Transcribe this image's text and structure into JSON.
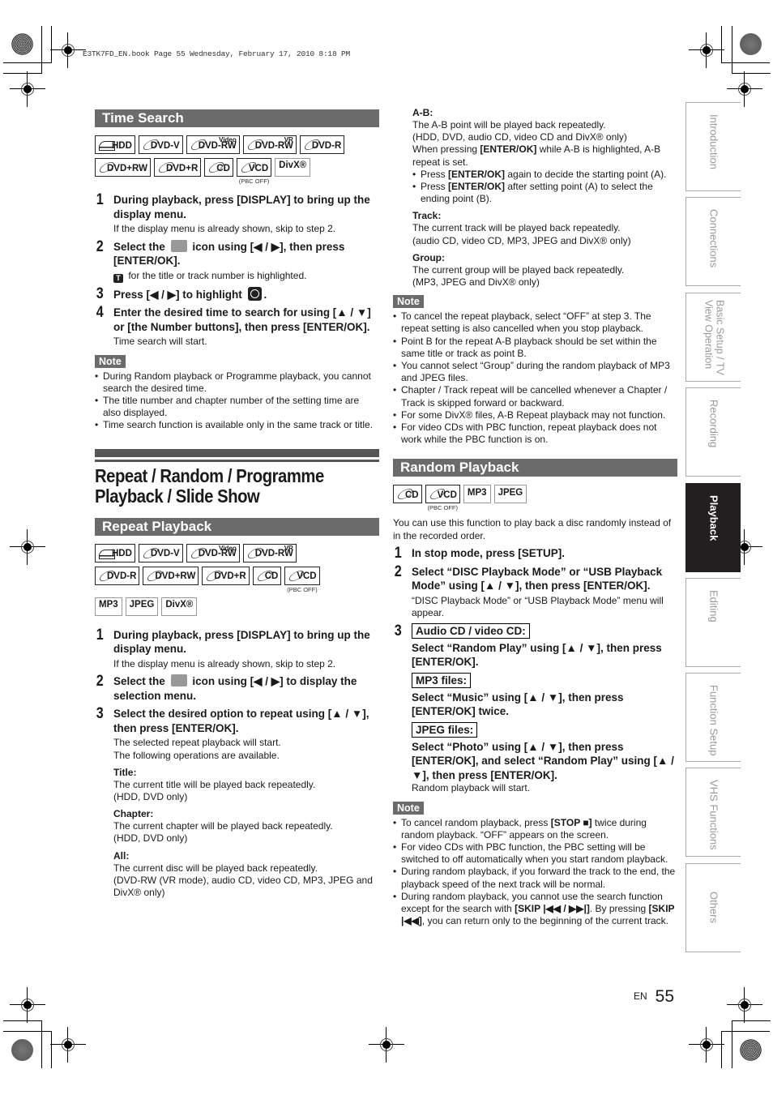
{
  "slug": "E3TK7FD_EN.book  Page 55  Wednesday, February 17, 2010  8:18 PM",
  "time_search": {
    "heading": "Time Search",
    "media_row1": [
      {
        "label": "HDD",
        "type": "hdd"
      },
      {
        "label": "DVD-V",
        "type": "disc"
      },
      {
        "label": "DVD-RW",
        "type": "disc",
        "sup": "Video"
      },
      {
        "label": "DVD-RW",
        "type": "disc",
        "sup": "VR"
      },
      {
        "label": "DVD-R",
        "type": "disc"
      }
    ],
    "media_row2": [
      {
        "label": "DVD+RW",
        "type": "disc"
      },
      {
        "label": "DVD+R",
        "type": "disc"
      },
      {
        "label": "CD",
        "type": "disc"
      },
      {
        "label": "VCD",
        "type": "disc",
        "note": "(PBC OFF)"
      },
      {
        "label": "DivX®",
        "type": "plain"
      }
    ],
    "steps": [
      {
        "num": "1",
        "text": "During playback, press [DISPLAY] to bring up the display menu.",
        "sub": "If the display menu is already shown, skip to step 2."
      },
      {
        "num": "2",
        "text_a": "Select the",
        "text_b": "icon using [◀ / ▶], then press [ENTER/OK].",
        "sub_icon": "T",
        "sub": "for the title or track number is highlighted."
      },
      {
        "num": "3",
        "text": "Press [◀ / ▶] to highlight",
        "icon": "clock-icon"
      },
      {
        "num": "4",
        "text": "Enter the desired time to search for using [▲ / ▼] or [the Number buttons], then press [ENTER/OK].",
        "sub": "Time search will start."
      }
    ],
    "note_label": "Note",
    "notes": [
      "During Random playback or Programme playback, you cannot search the desired time.",
      "The title number and chapter number of the setting time are also displayed.",
      "Time search function is available only in the same track or title."
    ]
  },
  "chapter_title": "Repeat / Random / Programme Playback / Slide Show",
  "repeat": {
    "heading": "Repeat Playback",
    "media_row1": [
      {
        "label": "HDD",
        "type": "hdd"
      },
      {
        "label": "DVD-V",
        "type": "disc"
      },
      {
        "label": "DVD-RW",
        "type": "disc",
        "sup": "Video"
      },
      {
        "label": "DVD-RW",
        "type": "disc",
        "sup": "VR"
      }
    ],
    "media_row2": [
      {
        "label": "DVD-R",
        "type": "disc"
      },
      {
        "label": "DVD+RW",
        "type": "disc"
      },
      {
        "label": "DVD+R",
        "type": "disc"
      },
      {
        "label": "CD",
        "type": "disc"
      },
      {
        "label": "VCD",
        "type": "disc",
        "note": "(PBC OFF)"
      }
    ],
    "media_row3": [
      {
        "label": "MP3",
        "type": "plain"
      },
      {
        "label": "JPEG",
        "type": "plain"
      },
      {
        "label": "DivX®",
        "type": "plain"
      }
    ],
    "steps": [
      {
        "num": "1",
        "text": "During playback, press [DISPLAY] to bring up the display menu.",
        "sub": "If the display menu is already shown, skip to step 2."
      },
      {
        "num": "2",
        "text_a": "Select the",
        "text_b": "icon using [◀ / ▶] to display the selection menu."
      },
      {
        "num": "3",
        "text": "Select the desired option to repeat using [▲ / ▼], then press [ENTER/OK].",
        "sub1": "The selected repeat playback will start.",
        "sub2": "The following operations are available."
      }
    ],
    "options": [
      {
        "title": "Title:",
        "lines": [
          "The current title will be played back repeatedly.",
          "(HDD, DVD only)"
        ]
      },
      {
        "title": "Chapter:",
        "lines": [
          "The current chapter will be played back repeatedly.",
          "(HDD, DVD only)"
        ]
      },
      {
        "title": "All:",
        "lines": [
          "The current disc will be played back repeatedly.",
          "(DVD-RW (VR mode), audio CD, video CD, MP3, JPEG and DivX® only)"
        ]
      }
    ],
    "ab": {
      "title": "A-B:",
      "lines": [
        "The A-B point will be played back repeatedly.",
        "(HDD, DVD, audio CD, video CD and DivX® only)"
      ],
      "when_a": "When pressing ",
      "when_b": "[ENTER/OK]",
      "when_c": " while A-B is highlighted, A-B repeat is set.",
      "bullets": [
        {
          "pre": "Press ",
          "key": "[ENTER/OK]",
          "post": " again to decide the starting point (A)."
        },
        {
          "pre": "Press ",
          "key": "[ENTER/OK]",
          "post": " after setting point (A) to select the ending point (B)."
        }
      ]
    },
    "track": {
      "title": "Track:",
      "lines": [
        "The current track will be played back repeatedly.",
        "(audio CD, video CD, MP3, JPEG and DivX® only)"
      ]
    },
    "group": {
      "title": "Group:",
      "lines": [
        "The current group will be played back repeatedly.",
        "(MP3, JPEG and DivX® only)"
      ]
    },
    "note_label": "Note",
    "notes": [
      "To cancel the repeat playback, select “OFF” at step 3. The repeat setting is also cancelled when you stop playback.",
      "Point B for the repeat A-B playback should be set within the same title or track as point B.",
      "You cannot select “Group” during the random playback of MP3 and JPEG files.",
      "Chapter / Track repeat will be cancelled whenever a Chapter / Track is skipped forward or backward.",
      "For some DivX® files, A-B Repeat playback may not function.",
      "For video CDs with PBC function, repeat playback does not work while the PBC function is on."
    ]
  },
  "random": {
    "heading": "Random Playback",
    "media": [
      {
        "label": "CD",
        "type": "disc"
      },
      {
        "label": "VCD",
        "type": "disc",
        "note": "(PBC OFF)"
      },
      {
        "label": "MP3",
        "type": "plain"
      },
      {
        "label": "JPEG",
        "type": "plain"
      }
    ],
    "intro": "You can use this function to play back a disc randomly instead of in the recorded order.",
    "step1": {
      "num": "1",
      "text": "In stop mode, press [SETUP]."
    },
    "step2": {
      "num": "2",
      "text": "Select “DISC Playback Mode” or “USB Playback Mode” using [▲ / ▼], then press [ENTER/OK].",
      "sub": "“DISC Playback Mode” or “USB Playback Mode” menu will appear."
    },
    "step3": {
      "num": "3",
      "cases": [
        {
          "label": "Audio CD / video CD:",
          "text": "Select “Random Play” using [▲ / ▼], then press [ENTER/OK]."
        },
        {
          "label": "MP3 files:",
          "text": "Select “Music” using [▲ / ▼], then press [ENTER/OK] twice."
        },
        {
          "label": "JPEG files:",
          "text": "Select “Photo” using [▲ / ▼], then press [ENTER/OK], and select “Random Play” using [▲ / ▼], then press [ENTER/OK]."
        }
      ],
      "sub": "Random playback will start."
    },
    "note_label": "Note",
    "notes": [
      {
        "pre": "To cancel random playback, press ",
        "key": "[STOP ■]",
        "post": " twice during random playback. “OFF” appears on the screen."
      },
      {
        "pre": "For video CDs with PBC function, the PBC setting will be switched to off automatically when you start random playback.",
        "key": "",
        "post": ""
      },
      {
        "pre": "During random playback, if you forward the track to the end, the playback speed of the next track will be normal.",
        "key": "",
        "post": ""
      },
      {
        "pre": "During random playback, you cannot use the search function except for the search with ",
        "key": "[SKIP |◀◀ / ▶▶|]",
        "post": ". By pressing ",
        "key2": "[SKIP |◀◀]",
        "post2": ", you can return only to the beginning of the current track."
      }
    ]
  },
  "side_tabs": [
    {
      "label": "Introduction",
      "active": false
    },
    {
      "label": "Connections",
      "active": false
    },
    {
      "label": "Basic Setup / TV View Operation",
      "active": false
    },
    {
      "label": "Recording",
      "active": false
    },
    {
      "label": "Playback",
      "active": true
    },
    {
      "label": "Editing",
      "active": false
    },
    {
      "label": "Function Setup",
      "active": false
    },
    {
      "label": "VHS Functions",
      "active": false
    },
    {
      "label": "Others",
      "active": false
    }
  ],
  "footer": {
    "lang": "EN",
    "page": "55"
  }
}
